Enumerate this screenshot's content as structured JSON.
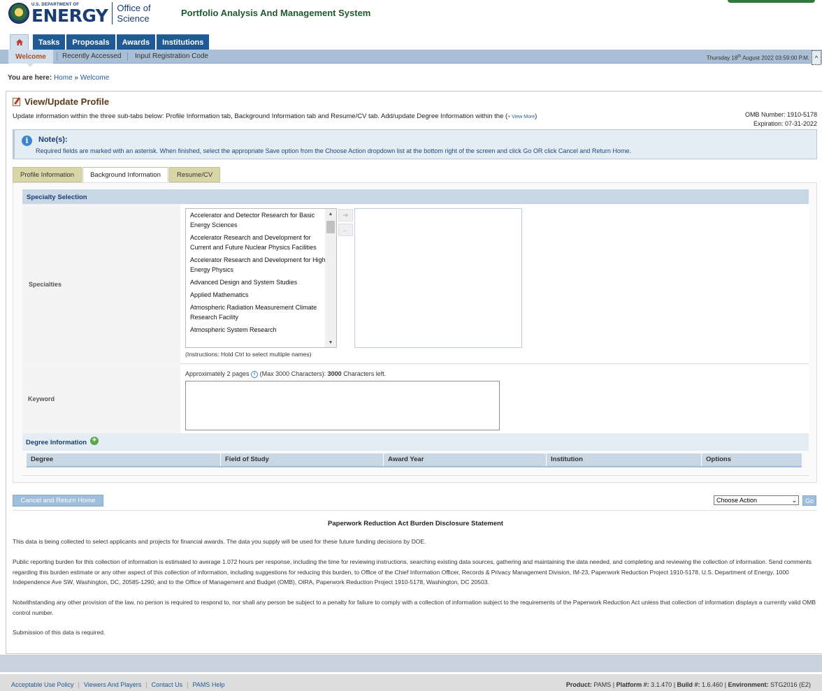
{
  "header": {
    "agency_small": "U.S. DEPARTMENT OF",
    "agency_big": "ENERGY",
    "office_line1": "Office of",
    "office_line2": "Science",
    "system_title": "Portfolio Analysis And Management System"
  },
  "primary_nav": {
    "home_icon": "home-icon",
    "tabs": [
      "Tasks",
      "Proposals",
      "Awards",
      "Institutions"
    ]
  },
  "sub_nav": {
    "items": [
      "Welcome",
      "Recently Accessed",
      "Input Registration Code"
    ],
    "datetime_day": "Thursday 18",
    "datetime_sup": "th",
    "datetime_rest": " August 2022 03:59:00 P.M."
  },
  "breadcrumb": {
    "label": "You are here:",
    "home": "Home",
    "separator": "»",
    "current": "Welcome"
  },
  "page": {
    "title": "View/Update Profile",
    "description": "Update information within the three sub-tabs below: Profile Information tab, Background Information tab and Resume/CV tab. Add/update Degree Information within the (",
    "view_more": "+ View More",
    "description_close": ")",
    "omb_number": "OMB Number: 1910-5178",
    "expiration": "Expiration: 07-31-2022"
  },
  "notes": {
    "title": "Note(s):",
    "text": "Required fields are marked with an asterisk. When finished, select the appropriate Save option from the Choose Action dropdown list at the bottom right of the screen and click Go OR click Cancel and Return Home."
  },
  "tabs": {
    "items": [
      "Profile Information",
      "Background Information",
      "Resume/CV"
    ],
    "active": "Background Information"
  },
  "specialty": {
    "section_title": "Specialty Selection",
    "label": "Specialties",
    "options": [
      "Accelerator and Detector Research for Basic Energy Sciences",
      "Accelerator Research and Development for Current and Future Nuclear Physics Facilities",
      "Accelerator Research and Development for High Energy Physics",
      "Advanced Design and System Studies",
      "Applied Mathematics",
      "Atmospheric Radiation Measurement Climate Research Facility",
      "Atmospheric System Research"
    ],
    "instructions": "(Instructions: Hold Ctrl to select multiple names)"
  },
  "keyword": {
    "label": "Keyword",
    "hint_prefix": "Approximately 2 pages",
    "hint_middle": "(Max 3000 Characters):",
    "chars_left": "3000",
    "hint_suffix": "Characters left.",
    "value": ""
  },
  "degree": {
    "title": "Degree Information",
    "columns": [
      "Degree",
      "Field of Study",
      "Award Year",
      "Institution",
      "Options"
    ]
  },
  "actions": {
    "cancel_label": "Cancel and Return Home",
    "choose_action_selected": "Choose Action",
    "go_label": "Go"
  },
  "paperwork": {
    "title": "Paperwork Reduction Act Burden Disclosure Statement",
    "p1": "This data is being collected to select applicants and projects for financial awards. The data you supply will be used for these future funding decisions by DOE.",
    "p2": "Public reporting burden for this collection of information is estimated to average 1.072 hours per response, including the time for reviewing instructions, searching existing data sources, gathering and maintaining the data needed, and completing and reviewing the collection of information. Send comments regarding this burden estimate or any other aspect of this collection of information, including suggestions for reducing this burden, to Office of the Chief Information Officer, Records & Privacy Management Division, IM-23, Paperwork Reduction Project 1910-5178, U.S. Department of Energy, 1000 Independence Ave SW, Washington, DC, 20585-1290; and to the Office of Management and Budget (OMB), OIRA, Paperwork Reduction Project 1910-5178, Washington, DC 20503.",
    "p3": "Notwithstanding any other provision of the law, no person is required to respond to, nor shall any person be subject to a penalty for failure to comply with a collection of information subject to the requirements of the Paperwork Reduction Act unless that collection of information displays a currently valid OMB control number.",
    "p4": "Submission of this data is required."
  },
  "footer": {
    "links": [
      "Acceptable Use Policy",
      "Viewers And Players",
      "Contact Us",
      "PAMS Help"
    ],
    "product_label": "Product:",
    "product_value": "PAMS",
    "platform_label": "Platform #:",
    "platform_value": "3.1.470",
    "build_label": "Build #:",
    "build_value": "1.6.460",
    "environment_label": "Environment:",
    "environment_value": "STG2016 (E2)"
  },
  "colors": {
    "nav_blue": "#1f5a96",
    "subnav_blue": "#a9bfd6",
    "tab_olive": "#d8d5a8",
    "title_brown": "#5a3a1a",
    "system_title_green": "#1e5a2b"
  }
}
